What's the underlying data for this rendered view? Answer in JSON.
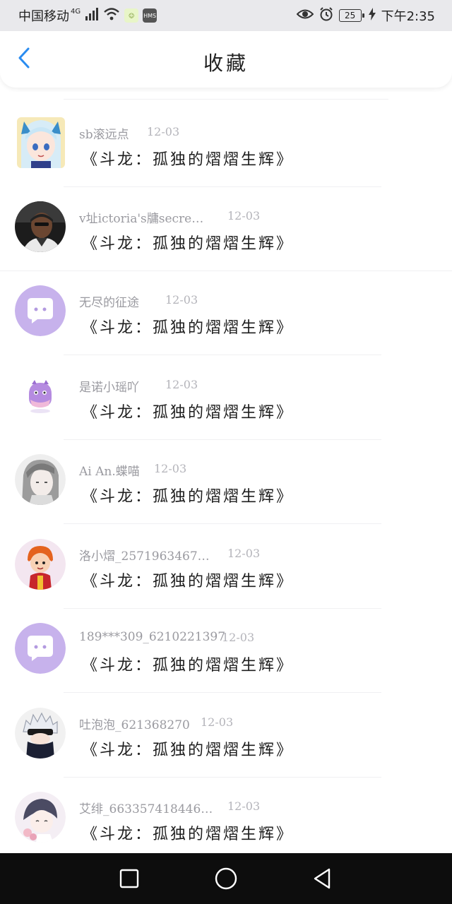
{
  "status_bar": {
    "carrier": "中国移动",
    "network": "4G",
    "battery": "25",
    "time": "下午2:35"
  },
  "header": {
    "title": "收藏",
    "back_icon": "chevron-left-icon",
    "accent": "#2a8cf0"
  },
  "favorites": [
    {
      "user": "sb滚远点",
      "date": "12-03",
      "title": "《斗龙：孤独的熠熠生辉》",
      "avatar": "anime-girl-cat-ears"
    },
    {
      "user": "v址ictoria's牗secre…",
      "date": "12-03",
      "title": "《斗龙：孤独的熠熠生辉》",
      "avatar": "man-photo"
    },
    {
      "user": "无尽的征途",
      "date": "12-03",
      "title": "《斗龙：孤独的熠熠生辉》",
      "avatar": "default-chat-bubble"
    },
    {
      "user": "是诺小瑶吖",
      "date": "12-03",
      "title": "《斗龙：孤独的熠熠生辉》",
      "avatar": "purple-monster"
    },
    {
      "user": "Ai An.蝶喵",
      "date": "12-03",
      "title": "《斗龙：孤独的熠熠生辉》",
      "avatar": "anime-grey-hair"
    },
    {
      "user": "洛小熠_2571963467…",
      "date": "12-03",
      "title": "《斗龙：孤独的熠熠生辉》",
      "avatar": "cartoon-orange-hair"
    },
    {
      "user": "189***309_6210221397",
      "date": "12-03",
      "title": "《斗龙：孤独的熠熠生辉》",
      "avatar": "default-chat-bubble"
    },
    {
      "user": "吐泡泡_621368270",
      "date": "12-03",
      "title": "《斗龙：孤独的熠熠生辉》",
      "avatar": "anime-white-hair-mask"
    },
    {
      "user": "艾绯_663357418446…",
      "date": "12-03",
      "title": "《斗龙：孤独的熠熠生辉》",
      "avatar": "anime-boy-purple"
    }
  ],
  "nav": {
    "recents_icon": "square-icon",
    "home_icon": "circle-icon",
    "back_icon": "triangle-back-icon"
  }
}
